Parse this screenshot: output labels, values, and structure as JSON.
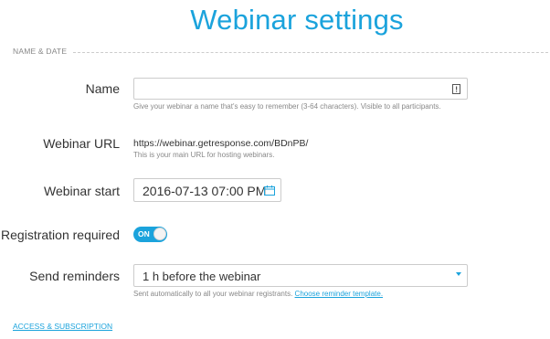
{
  "page": {
    "title": "Webinar settings"
  },
  "section": {
    "name_date": "NAME & DATE"
  },
  "name": {
    "label": "Name",
    "value": "",
    "placeholder": "",
    "helper": "Give your webinar a name that's easy to remember (3-64 characters). Visible to all participants.",
    "icon": "info-icon"
  },
  "url": {
    "label": "Webinar URL",
    "value": "https://webinar.getresponse.com/BDnPB/",
    "helper": "This is your main URL for hosting webinars."
  },
  "start": {
    "label": "Webinar start",
    "value": "2016-07-13 07:00 PM",
    "icon": "calendar-icon"
  },
  "registration": {
    "label": "Registration required",
    "toggle_text": "ON",
    "on": true
  },
  "reminders": {
    "label": "Send reminders",
    "selected": "1 h before the webinar",
    "helper": "Sent automatically to all your webinar registrants.",
    "link": "Choose reminder template."
  },
  "access": {
    "link": "ACCESS & SUBSCRIPTION"
  },
  "colors": {
    "accent": "#1ba3dc",
    "border": "#cccccc",
    "muted": "#888888"
  }
}
